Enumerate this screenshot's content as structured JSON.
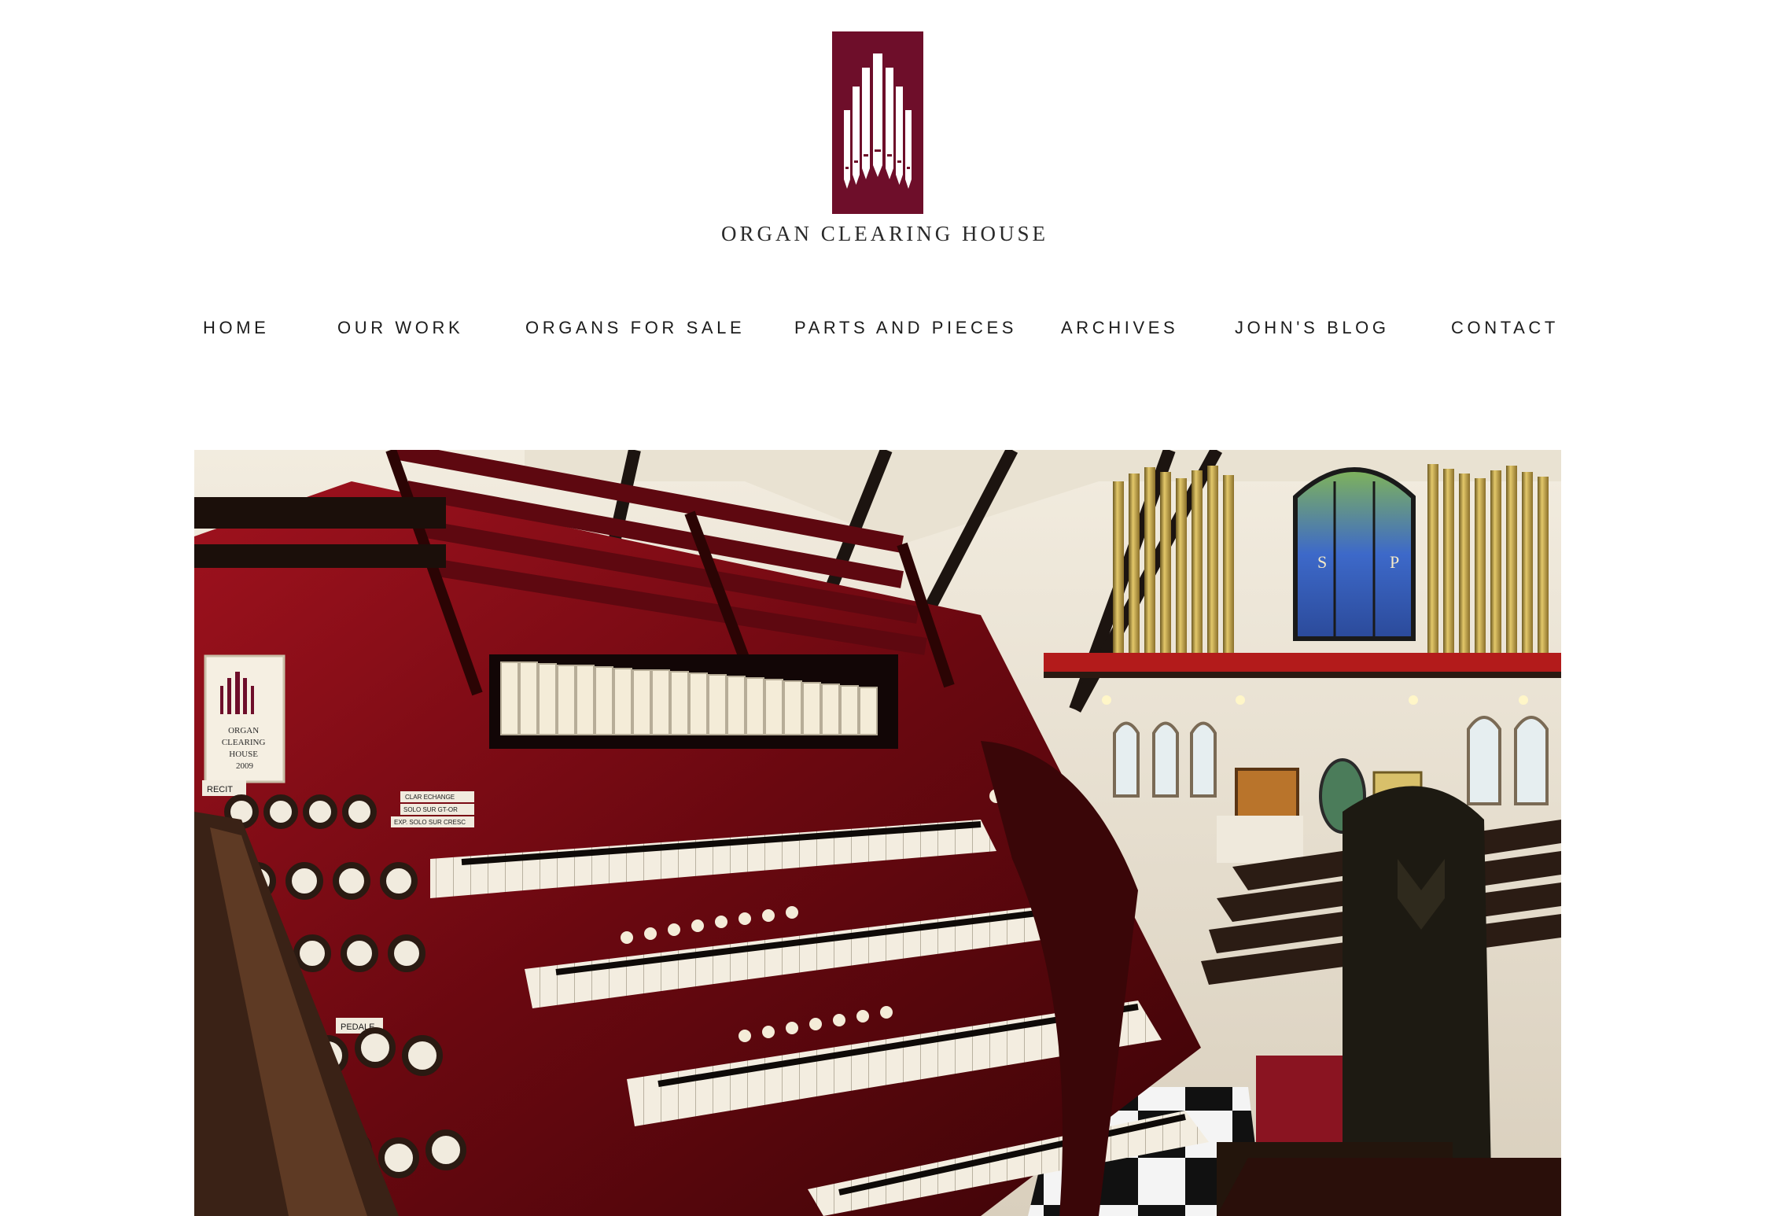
{
  "site": {
    "logo_text": "ORGAN CLEARING HOUSE",
    "logo_color": "#6e0e2a"
  },
  "nav": {
    "items": [
      {
        "label": "HOME"
      },
      {
        "label": "OUR WORK"
      },
      {
        "label": "ORGANS FOR SALE"
      },
      {
        "label": "PARTS AND PIECES"
      },
      {
        "label": "ARCHIVES"
      },
      {
        "label": "JOHN'S BLOG"
      },
      {
        "label": "CONTACT"
      }
    ]
  },
  "hero": {
    "plaque_text": [
      "ORGAN",
      "CLEARING",
      "HOUSE",
      "2009"
    ],
    "console_labels": {
      "recit": "RECIT",
      "pedale": "PEDALE",
      "couplers": [
        "CLAR ECHANGE",
        "SOLO SUR GT-OR",
        "EXP. SOLO SUR CRESC"
      ]
    },
    "window_letters": [
      "S",
      "P"
    ]
  }
}
